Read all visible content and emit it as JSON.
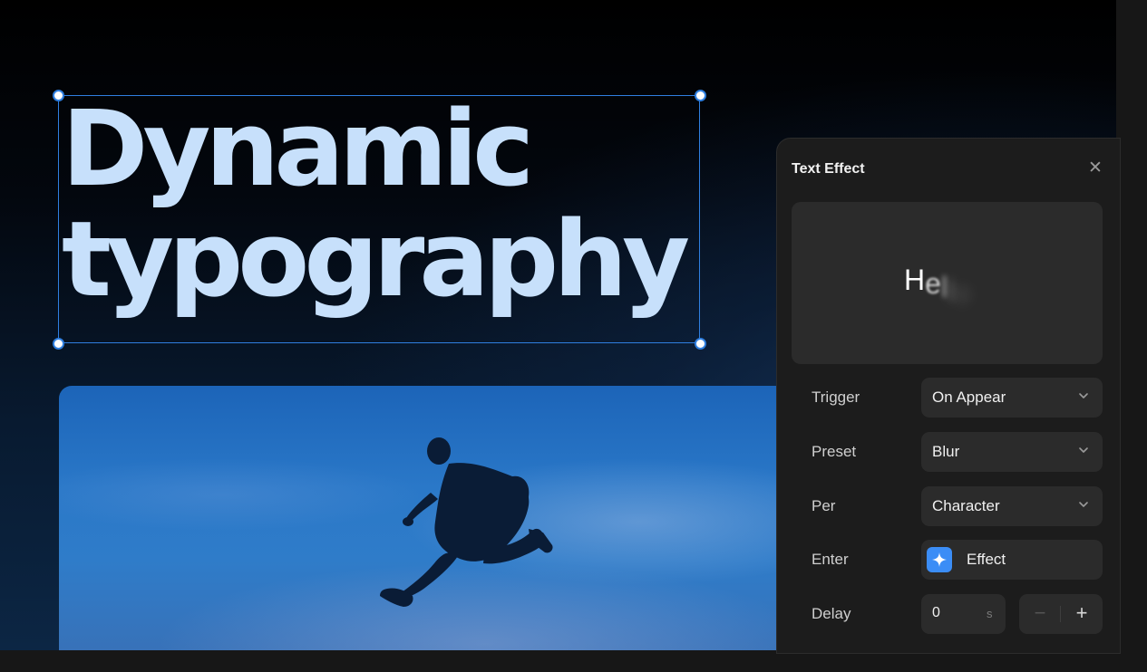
{
  "canvas": {
    "headline_lines": [
      "Dynamic",
      "typography"
    ],
    "accent_color": "#2f7fe0",
    "headline_color": "#c7e0fb"
  },
  "panel": {
    "title": "Text Effect",
    "close_icon": "close-icon",
    "preview": {
      "chars": [
        "H",
        "e",
        "l",
        "l",
        "o"
      ]
    },
    "rows": {
      "trigger": {
        "label": "Trigger",
        "value": "On Appear"
      },
      "preset": {
        "label": "Preset",
        "value": "Blur"
      },
      "per": {
        "label": "Per",
        "value": "Character"
      },
      "enter": {
        "label": "Enter",
        "value": "Effect",
        "icon": "sparkle-icon",
        "badge_color": "#3b8df6"
      },
      "delay": {
        "label": "Delay",
        "value": "0",
        "unit": "s",
        "minus": "−",
        "plus": "+"
      }
    }
  }
}
